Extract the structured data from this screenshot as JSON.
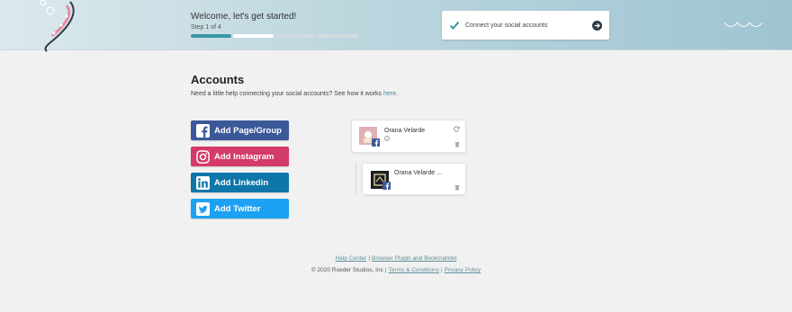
{
  "header": {
    "welcome": "Welcome, let's get started!",
    "step": "Step 1 of 4",
    "progress_steps": 4,
    "progress_done": 1,
    "task": "Connect your social accounts"
  },
  "main": {
    "title": "Accounts",
    "help_text": "Need a little help connecting your social accounts? See how it works",
    "help_link": "here",
    "help_end": "."
  },
  "buttons": {
    "facebook": "Add Page/Group",
    "instagram": "Add Instagram",
    "linkedin": "Add Linkedin",
    "twitter": "Add Twitter"
  },
  "accounts": [
    {
      "name": "Orana Velarde",
      "network": "facebook"
    },
    {
      "name": "Orana Velarde ...",
      "network": "facebook"
    }
  ],
  "footer": {
    "help_center": "Help Center",
    "divider": "|",
    "plugin": "Browser Plugin and Bookmarklet",
    "copyright": "© 2020 Roeder Studios, Inc",
    "terms": "Terms & Conditions",
    "privacy": "Privacy Policy"
  },
  "colors": {
    "facebook": "#3b5998",
    "instagram": "#d43a6a",
    "linkedin": "#0e76a8",
    "twitter": "#1da1f2",
    "accent": "#3a97a3"
  }
}
